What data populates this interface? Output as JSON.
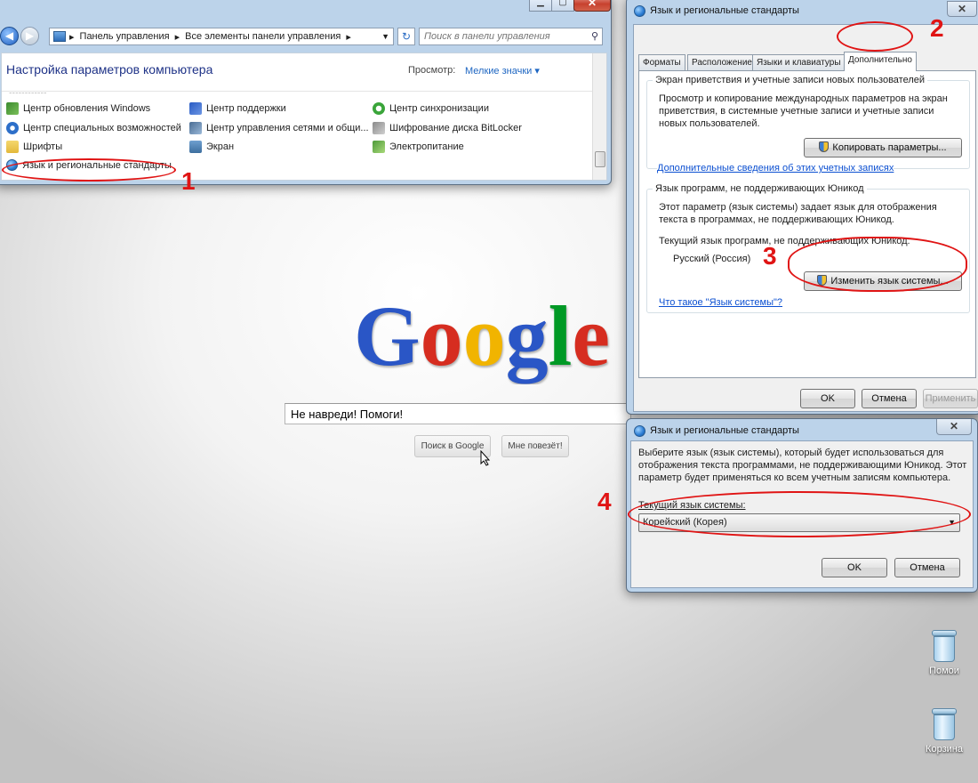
{
  "control_panel": {
    "nav": {
      "breadcrumb_root": "Панель управления",
      "breadcrumb_current": "Все элементы панели управления",
      "search_placeholder": "Поиск в панели управления"
    },
    "heading": "Настройка параметров компьютера",
    "view_label": "Просмотр:",
    "view_value": "Мелкие значки",
    "items": [
      {
        "label": "Центр обновления Windows",
        "icon": "windows-update-icon",
        "color": "#3a8a2e"
      },
      {
        "label": "Центр поддержки",
        "icon": "action-center-flag-icon",
        "color": "#2a5cc4"
      },
      {
        "label": "Центр синхронизации",
        "icon": "sync-center-icon",
        "color": "#3aa53a"
      },
      {
        "label": "Центр специальных возможностей",
        "icon": "accessibility-icon",
        "color": "#2d6fc9"
      },
      {
        "label": "Центр управления сетями и общи...",
        "icon": "network-center-icon",
        "color": "#4a6d94"
      },
      {
        "label": "Шифрование диска BitLocker",
        "icon": "bitlocker-icon",
        "color": "#8a8a8a"
      },
      {
        "label": "Шрифты",
        "icon": "fonts-folder-icon",
        "color": "#e3b93b"
      },
      {
        "label": "Экран",
        "icon": "display-icon",
        "color": "#3d6e9e"
      },
      {
        "label": "Электропитание",
        "icon": "power-options-icon",
        "color": "#4d9a3a"
      },
      {
        "label": "Язык и региональные стандарты",
        "icon": "region-language-icon",
        "color": "#2a7bd3"
      }
    ]
  },
  "google": {
    "logo_letters": [
      "G",
      "o",
      "o",
      "g",
      "l",
      "e"
    ],
    "logo_colors": [
      "#2a56c6",
      "#d62d20",
      "#f1b400",
      "#2a56c6",
      "#009925",
      "#d62d20"
    ],
    "search_value": "Не навреди! Помоги!",
    "search_button": "Поиск в Google",
    "lucky_button": "Мне повезёт!"
  },
  "region_dialog": {
    "title": "Язык и региональные стандарты",
    "tabs": [
      "Форматы",
      "Расположение",
      "Языки и клавиатуры",
      "Дополнительно"
    ],
    "selected_tab": "Дополнительно",
    "welcome_group": {
      "title": "Экран приветствия и учетные записи новых пользователей",
      "text": "Просмотр и копирование международных параметров на экран приветствия, в системные учетные записи и учетные записи новых пользователей.",
      "button": "Копировать параметры...",
      "link": "Дополнительные сведения об этих учетных записях"
    },
    "nonunicode_group": {
      "title": "Язык программ, не поддерживающих Юникод",
      "text": "Этот параметр (язык системы) задает язык для отображения текста в программах, не поддерживающих Юникод.",
      "current_label": "Текущий язык программ, не поддерживающих Юникод:",
      "current_value": "Русский (Россия)",
      "button": "Изменить язык системы...",
      "link": "Что такое \"Язык системы\"?"
    },
    "ok": "OK",
    "cancel": "Отмена",
    "apply": "Применить"
  },
  "system_locale_dialog": {
    "title": "Язык и региональные стандарты",
    "text": "Выберите язык (язык системы), который будет использоваться для отображения текста программами, не поддерживающими Юникод. Этот параметр будет применяться ко всем учетным записям компьютера.",
    "label": "Текущий язык системы:",
    "selected": "Корейский (Корея)",
    "ok": "OK",
    "cancel": "Отмена"
  },
  "annotations": [
    "1",
    "2",
    "3",
    "4"
  ],
  "desktop_icons": [
    {
      "label": "Помои",
      "icon": "recycle-bin-icon"
    },
    {
      "label": "Корзина",
      "icon": "recycle-bin-icon"
    }
  ],
  "colors": {
    "annotation_red": "#e01414",
    "link_blue": "#0b4fd1",
    "window_frame": "#bcd3ea"
  }
}
